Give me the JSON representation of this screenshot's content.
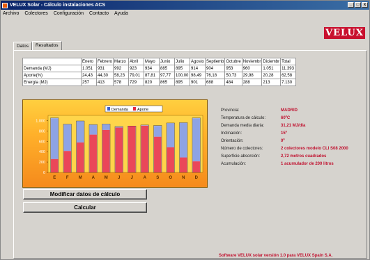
{
  "window": {
    "title": "VELUX Solar - Cálculo instalaciones ACS",
    "min": "_",
    "max": "□",
    "close": "x"
  },
  "menu": [
    "Archivo",
    "Colectores",
    "Configuración",
    "Contacto",
    "Ayuda"
  ],
  "logo": "VELUX",
  "tabs": [
    "Datos",
    "Resultados"
  ],
  "table": {
    "headers": [
      "",
      "Enero",
      "Febrero",
      "Marzo",
      "Abril",
      "Mayo",
      "Junio",
      "Julio",
      "Agosto",
      "Septiemb",
      "Octubre",
      "Noviembr",
      "Diciembr",
      "Total"
    ],
    "rows": [
      [
        "Demanda (MJ)",
        "1.051",
        "931",
        "992",
        "923",
        "934",
        "885",
        "895",
        "914",
        "904",
        "953",
        "960",
        "1.051",
        "11.393"
      ],
      [
        "Aporte(%)",
        "24,43",
        "44,30",
        "58,23",
        "79,01",
        "87,81",
        "97,77",
        "100,00",
        "98,49",
        "76,18",
        "50,73",
        "29,98",
        "20,28",
        "62,58"
      ],
      [
        "Energía (MJ)",
        "257",
        "413",
        "578",
        "729",
        "820",
        "865",
        "895",
        "901",
        "688",
        "484",
        "288",
        "213",
        "7.130"
      ]
    ]
  },
  "chart_data": {
    "type": "bar",
    "categories": [
      "E",
      "F",
      "M",
      "A",
      "M",
      "J",
      "J",
      "A",
      "S",
      "O",
      "N",
      "D"
    ],
    "series": [
      {
        "name": "Demanda",
        "values": [
          1051,
          931,
          992,
          923,
          934,
          885,
          895,
          914,
          904,
          953,
          960,
          1051
        ],
        "color": "#3a5fcd"
      },
      {
        "name": "Aporte",
        "values": [
          257,
          413,
          578,
          729,
          820,
          865,
          895,
          901,
          688,
          484,
          288,
          213
        ],
        "color": "#e8283c"
      }
    ],
    "yticks": [
      "0",
      "200",
      "400",
      "600",
      "800",
      "1.000"
    ],
    "ylim": [
      0,
      1100
    ],
    "legend": "top"
  },
  "info": [
    {
      "label": "Provincia:",
      "value": "MADRID"
    },
    {
      "label": "Temperatura de cálculo:",
      "value": "60ºC"
    },
    {
      "label": "Demanda media diaria:",
      "value": "31,21 MJ/día"
    },
    {
      "label": "Inclinación:",
      "value": "15º"
    },
    {
      "label": "Orientación:",
      "value": "0º"
    },
    {
      "label": "Número de colectores:",
      "value": "2 colectores modelo CLI S08 2000"
    },
    {
      "label": "Superficie absorción:",
      "value": "2,72 metros cuadrados"
    },
    {
      "label": "Acumulación:",
      "value": "1 acumulador de 200 litros"
    }
  ],
  "buttons": {
    "modify": "Modificar datos de cálculo",
    "calculate": "Calcular"
  },
  "status": "Software VELUX solar versión 1.0 para VELUX Spain S.A."
}
